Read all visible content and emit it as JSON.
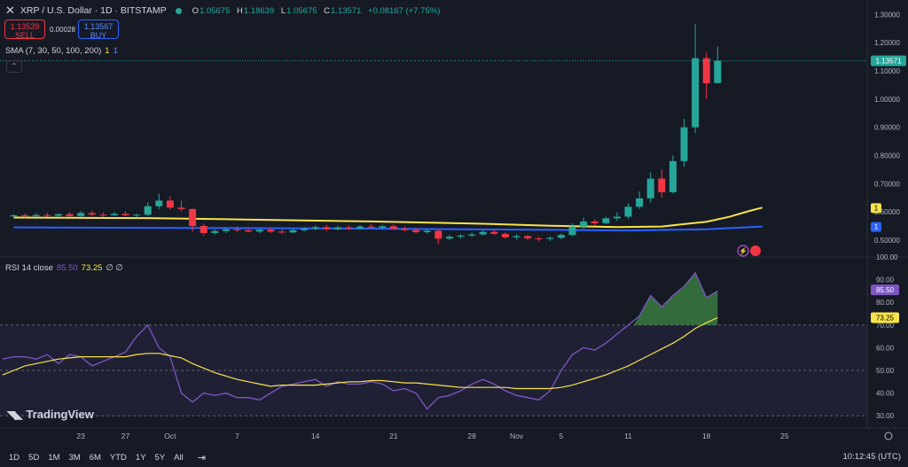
{
  "header": {
    "title": "XRP / U.S. Dollar · 1D · BITSTAMP",
    "o_label": "O",
    "o_value": "1.05675",
    "h_label": "H",
    "h_value": "1.18639",
    "l_label": "L",
    "l_value": "1.05675",
    "c_label": "C",
    "c_value": "1.13571",
    "change": "+0.08167 (+7.75%)"
  },
  "trade": {
    "sell_price": "1.13539",
    "sell_label": "SELL",
    "buy_price": "1.13567",
    "buy_label": "BUY",
    "spread": "0.00028"
  },
  "sma": {
    "label": "SMA (7, 30, 50, 100, 200)",
    "v1": "1",
    "v2": "1"
  },
  "rsi": {
    "label": "RSI 14 close",
    "value": "85.50",
    "ma_value": "73.25",
    "extra": "∅ ∅"
  },
  "price_axis": {
    "ticks": [
      "1.30000",
      "1.20000",
      "1.10000",
      "1.00000",
      "0.90000",
      "0.80000",
      "0.70000",
      "0.60000",
      "0.50000"
    ],
    "last_price": "1.13571",
    "sma_badge_1": "1",
    "sma_badge_2": "1"
  },
  "rsi_axis": {
    "ticks": [
      "100.00",
      "90.00",
      "80.00",
      "70.00",
      "60.00",
      "50.00",
      "40.00",
      "30.00"
    ],
    "rsi_badge": "85.50",
    "ma_badge": "73.25"
  },
  "time_axis": [
    "23",
    "27",
    "Oct",
    "7",
    "14",
    "21",
    "28",
    "Nov",
    "5",
    "11",
    "18",
    "25"
  ],
  "timeframes": [
    "1D",
    "5D",
    "1M",
    "3M",
    "6M",
    "YTD",
    "1Y",
    "5Y",
    "All"
  ],
  "clock": "10:12:45 (UTC)",
  "logo": "TradingView",
  "colors": {
    "up": "#26a69a",
    "down": "#f23645",
    "sma_yellow": "#f7e34a",
    "sma_blue": "#2962ff",
    "rsi": "#7e57c2",
    "bg": "#161a25"
  },
  "chart_data": {
    "type": "candlestick",
    "title": "XRP / U.S. Dollar · 1D · BITSTAMP",
    "ylim": [
      0.44,
      1.32
    ],
    "x_range": [
      "2024-09-17",
      "2024-11-30"
    ],
    "candles": [
      {
        "d": "2024-09-17",
        "o": 0.584,
        "h": 0.592,
        "l": 0.578,
        "c": 0.588
      },
      {
        "d": "2024-09-18",
        "o": 0.588,
        "h": 0.595,
        "l": 0.58,
        "c": 0.585
      },
      {
        "d": "2024-09-19",
        "o": 0.585,
        "h": 0.596,
        "l": 0.581,
        "c": 0.589
      },
      {
        "d": "2024-09-20",
        "o": 0.589,
        "h": 0.597,
        "l": 0.583,
        "c": 0.586
      },
      {
        "d": "2024-09-21",
        "o": 0.586,
        "h": 0.594,
        "l": 0.58,
        "c": 0.592
      },
      {
        "d": "2024-09-22",
        "o": 0.592,
        "h": 0.6,
        "l": 0.582,
        "c": 0.585
      },
      {
        "d": "2024-09-23",
        "o": 0.585,
        "h": 0.603,
        "l": 0.582,
        "c": 0.596
      },
      {
        "d": "2024-09-24",
        "o": 0.596,
        "h": 0.604,
        "l": 0.585,
        "c": 0.59
      },
      {
        "d": "2024-09-25",
        "o": 0.59,
        "h": 0.598,
        "l": 0.582,
        "c": 0.588
      },
      {
        "d": "2024-09-26",
        "o": 0.588,
        "h": 0.6,
        "l": 0.585,
        "c": 0.593
      },
      {
        "d": "2024-09-27",
        "o": 0.593,
        "h": 0.602,
        "l": 0.585,
        "c": 0.588
      },
      {
        "d": "2024-09-28",
        "o": 0.588,
        "h": 0.593,
        "l": 0.58,
        "c": 0.59
      },
      {
        "d": "2024-09-29",
        "o": 0.59,
        "h": 0.635,
        "l": 0.586,
        "c": 0.62
      },
      {
        "d": "2024-09-30",
        "o": 0.62,
        "h": 0.664,
        "l": 0.61,
        "c": 0.64
      },
      {
        "d": "2024-10-01",
        "o": 0.64,
        "h": 0.655,
        "l": 0.608,
        "c": 0.615
      },
      {
        "d": "2024-10-02",
        "o": 0.615,
        "h": 0.64,
        "l": 0.603,
        "c": 0.61
      },
      {
        "d": "2024-10-03",
        "o": 0.61,
        "h": 0.612,
        "l": 0.53,
        "c": 0.55
      },
      {
        "d": "2024-10-04",
        "o": 0.55,
        "h": 0.558,
        "l": 0.515,
        "c": 0.525
      },
      {
        "d": "2024-10-05",
        "o": 0.525,
        "h": 0.538,
        "l": 0.52,
        "c": 0.532
      },
      {
        "d": "2024-10-06",
        "o": 0.532,
        "h": 0.545,
        "l": 0.525,
        "c": 0.538
      },
      {
        "d": "2024-10-07",
        "o": 0.538,
        "h": 0.548,
        "l": 0.528,
        "c": 0.535
      },
      {
        "d": "2024-10-08",
        "o": 0.535,
        "h": 0.542,
        "l": 0.527,
        "c": 0.53
      },
      {
        "d": "2024-10-09",
        "o": 0.53,
        "h": 0.541,
        "l": 0.524,
        "c": 0.537
      },
      {
        "d": "2024-10-10",
        "o": 0.537,
        "h": 0.545,
        "l": 0.525,
        "c": 0.53
      },
      {
        "d": "2024-10-11",
        "o": 0.53,
        "h": 0.538,
        "l": 0.522,
        "c": 0.527
      },
      {
        "d": "2024-10-12",
        "o": 0.527,
        "h": 0.541,
        "l": 0.524,
        "c": 0.535
      },
      {
        "d": "2024-10-13",
        "o": 0.535,
        "h": 0.546,
        "l": 0.53,
        "c": 0.54
      },
      {
        "d": "2024-10-14",
        "o": 0.54,
        "h": 0.552,
        "l": 0.535,
        "c": 0.546
      },
      {
        "d": "2024-10-15",
        "o": 0.546,
        "h": 0.554,
        "l": 0.532,
        "c": 0.539
      },
      {
        "d": "2024-10-16",
        "o": 0.539,
        "h": 0.551,
        "l": 0.534,
        "c": 0.545
      },
      {
        "d": "2024-10-17",
        "o": 0.545,
        "h": 0.552,
        "l": 0.536,
        "c": 0.541
      },
      {
        "d": "2024-10-18",
        "o": 0.541,
        "h": 0.553,
        "l": 0.537,
        "c": 0.548
      },
      {
        "d": "2024-10-19",
        "o": 0.548,
        "h": 0.556,
        "l": 0.54,
        "c": 0.544
      },
      {
        "d": "2024-10-20",
        "o": 0.544,
        "h": 0.554,
        "l": 0.538,
        "c": 0.549
      },
      {
        "d": "2024-10-21",
        "o": 0.549,
        "h": 0.556,
        "l": 0.536,
        "c": 0.54
      },
      {
        "d": "2024-10-22",
        "o": 0.54,
        "h": 0.548,
        "l": 0.531,
        "c": 0.535
      },
      {
        "d": "2024-10-23",
        "o": 0.535,
        "h": 0.543,
        "l": 0.522,
        "c": 0.528
      },
      {
        "d": "2024-10-24",
        "o": 0.528,
        "h": 0.539,
        "l": 0.522,
        "c": 0.533
      },
      {
        "d": "2024-10-25",
        "o": 0.533,
        "h": 0.536,
        "l": 0.486,
        "c": 0.505
      },
      {
        "d": "2024-10-26",
        "o": 0.505,
        "h": 0.518,
        "l": 0.5,
        "c": 0.512
      },
      {
        "d": "2024-10-27",
        "o": 0.512,
        "h": 0.521,
        "l": 0.505,
        "c": 0.516
      },
      {
        "d": "2024-10-28",
        "o": 0.516,
        "h": 0.526,
        "l": 0.51,
        "c": 0.52
      },
      {
        "d": "2024-10-29",
        "o": 0.52,
        "h": 0.534,
        "l": 0.515,
        "c": 0.529
      },
      {
        "d": "2024-10-30",
        "o": 0.529,
        "h": 0.535,
        "l": 0.518,
        "c": 0.522
      },
      {
        "d": "2024-10-31",
        "o": 0.522,
        "h": 0.527,
        "l": 0.505,
        "c": 0.51
      },
      {
        "d": "2024-11-01",
        "o": 0.51,
        "h": 0.52,
        "l": 0.502,
        "c": 0.514
      },
      {
        "d": "2024-11-02",
        "o": 0.514,
        "h": 0.518,
        "l": 0.5,
        "c": 0.506
      },
      {
        "d": "2024-11-03",
        "o": 0.506,
        "h": 0.512,
        "l": 0.496,
        "c": 0.504
      },
      {
        "d": "2024-11-04",
        "o": 0.504,
        "h": 0.513,
        "l": 0.497,
        "c": 0.508
      },
      {
        "d": "2024-11-05",
        "o": 0.508,
        "h": 0.523,
        "l": 0.503,
        "c": 0.518
      },
      {
        "d": "2024-11-06",
        "o": 0.518,
        "h": 0.56,
        "l": 0.513,
        "c": 0.548
      },
      {
        "d": "2024-11-07",
        "o": 0.548,
        "h": 0.58,
        "l": 0.54,
        "c": 0.566
      },
      {
        "d": "2024-11-08",
        "o": 0.566,
        "h": 0.573,
        "l": 0.55,
        "c": 0.56
      },
      {
        "d": "2024-11-09",
        "o": 0.56,
        "h": 0.583,
        "l": 0.556,
        "c": 0.577
      },
      {
        "d": "2024-11-10",
        "o": 0.577,
        "h": 0.598,
        "l": 0.568,
        "c": 0.583
      },
      {
        "d": "2024-11-11",
        "o": 0.583,
        "h": 0.63,
        "l": 0.575,
        "c": 0.618
      },
      {
        "d": "2024-11-12",
        "o": 0.618,
        "h": 0.672,
        "l": 0.61,
        "c": 0.648
      },
      {
        "d": "2024-11-13",
        "o": 0.648,
        "h": 0.74,
        "l": 0.632,
        "c": 0.718
      },
      {
        "d": "2024-11-14",
        "o": 0.718,
        "h": 0.75,
        "l": 0.65,
        "c": 0.67
      },
      {
        "d": "2024-11-15",
        "o": 0.67,
        "h": 0.8,
        "l": 0.665,
        "c": 0.78
      },
      {
        "d": "2024-11-16",
        "o": 0.78,
        "h": 0.93,
        "l": 0.76,
        "c": 0.9
      },
      {
        "d": "2024-11-17",
        "o": 0.9,
        "h": 1.266,
        "l": 0.88,
        "c": 1.145
      },
      {
        "d": "2024-11-18",
        "o": 1.145,
        "h": 1.165,
        "l": 1.0,
        "c": 1.056
      },
      {
        "d": "2024-11-19",
        "o": 1.05675,
        "h": 1.18639,
        "l": 1.05675,
        "c": 1.13571
      }
    ],
    "sma_yellow": [
      [
        0,
        0.58
      ],
      [
        12,
        0.578
      ],
      [
        22,
        0.572
      ],
      [
        32,
        0.566
      ],
      [
        42,
        0.558
      ],
      [
        48,
        0.551
      ],
      [
        54,
        0.546
      ],
      [
        58,
        0.548
      ],
      [
        62,
        0.565
      ],
      [
        64,
        0.582
      ],
      [
        66,
        0.605
      ],
      [
        67,
        0.615
      ]
    ],
    "sma_blue": [
      [
        0,
        0.545
      ],
      [
        15,
        0.543
      ],
      [
        30,
        0.541
      ],
      [
        45,
        0.537
      ],
      [
        55,
        0.534
      ],
      [
        62,
        0.538
      ],
      [
        67,
        0.548
      ]
    ],
    "rsi": {
      "ylim": [
        25,
        100
      ],
      "bands": [
        30,
        50,
        70
      ],
      "values": [
        55,
        56,
        56,
        55,
        57,
        53,
        57,
        56,
        52,
        54,
        56,
        58,
        65,
        70,
        60,
        56,
        40,
        36,
        40,
        39,
        40,
        38,
        38,
        37,
        40,
        43,
        44,
        45,
        46,
        43,
        45,
        44,
        44,
        45,
        44,
        41,
        42,
        40,
        33,
        38,
        39,
        41,
        44,
        46,
        44,
        41,
        39,
        38,
        37,
        41,
        50,
        57,
        60,
        59,
        62,
        66,
        70,
        74,
        83,
        78,
        83,
        87,
        93,
        82,
        85
      ],
      "ma_values": [
        48,
        50,
        52,
        53,
        54,
        55,
        55.5,
        56,
        56,
        56,
        56,
        56,
        57,
        57.5,
        57.5,
        56.5,
        55.5,
        53,
        51,
        49,
        47.5,
        46,
        45,
        44,
        43,
        43.5,
        43.5,
        43.5,
        43.5,
        44,
        44.5,
        45,
        45,
        45.5,
        45.5,
        45,
        44.5,
        44.5,
        44,
        43.5,
        43,
        42.5,
        42.5,
        42.5,
        42.5,
        42.5,
        42,
        42,
        42,
        42,
        42.5,
        43.5,
        45,
        46.5,
        48,
        50,
        52,
        54.5,
        57,
        59.5,
        62,
        65,
        68.5,
        71,
        73.25
      ]
    }
  }
}
